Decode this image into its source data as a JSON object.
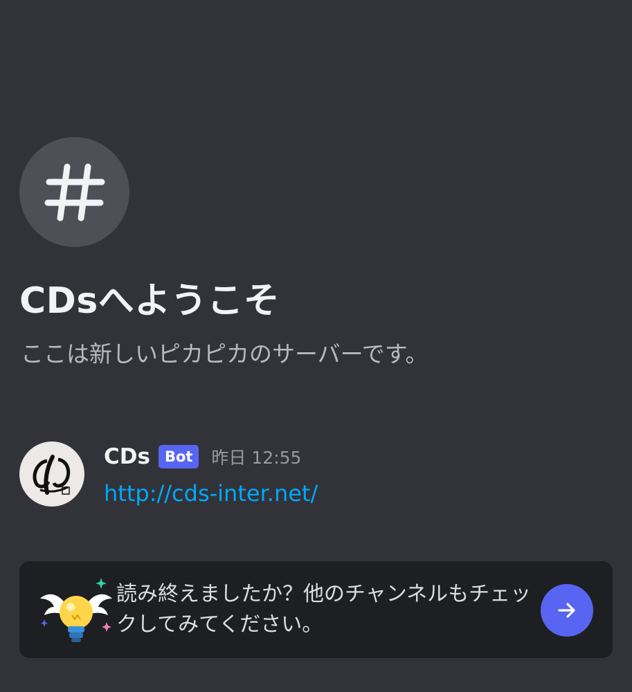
{
  "channel_intro": {
    "icon": "hash-icon",
    "title": "CDsへようこそ",
    "subtitle": "ここは新しいピカピカのサーバーです。"
  },
  "message": {
    "author": "CDs",
    "bot_tag": "Bot",
    "timestamp": "昨日 12:55",
    "link": "http://cds-inter.net/"
  },
  "tip_card": {
    "icon": "winged-lightbulb-icon",
    "text": "読み終えましたか？他のチャンネルもチェックしてみてください。",
    "next_icon": "arrow-right-icon"
  },
  "colors": {
    "background": "#313338",
    "card_background": "#1e1f22",
    "accent": "#5865f2",
    "link": "#00a8fc"
  }
}
